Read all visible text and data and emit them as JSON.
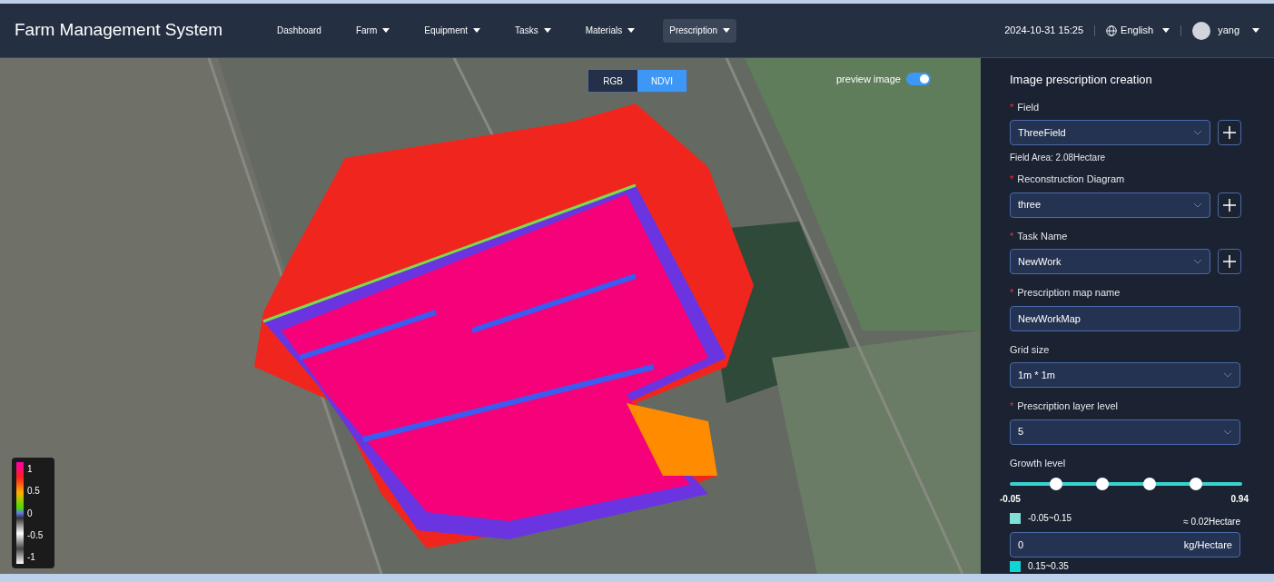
{
  "header": {
    "title": "Farm Management System",
    "nav": [
      {
        "label": "Dashboard",
        "dropdown": false,
        "selected": false
      },
      {
        "label": "Farm",
        "dropdown": true,
        "selected": false
      },
      {
        "label": "Equipment",
        "dropdown": true,
        "selected": false
      },
      {
        "label": "Tasks",
        "dropdown": true,
        "selected": false
      },
      {
        "label": "Materials",
        "dropdown": true,
        "selected": false
      },
      {
        "label": "Prescription",
        "dropdown": true,
        "selected": true
      }
    ],
    "datetime": "2024-10-31 15:25",
    "language": "English",
    "user": "yang"
  },
  "map": {
    "view_modes": [
      {
        "label": "RGB",
        "selected": false
      },
      {
        "label": "NDVI",
        "selected": true
      }
    ],
    "preview": {
      "label": "preview image",
      "on": true
    },
    "legend": [
      "1",
      "0.5",
      "0",
      "-0.5",
      "-1"
    ]
  },
  "panel": {
    "title": "Image prescription creation",
    "fields": [
      {
        "kind": "select_add",
        "label": "Field",
        "required_mark": "*",
        "value": "ThreeField",
        "note": "Field Area: 2.08Hectare"
      },
      {
        "kind": "select_add",
        "label": "Reconstruction Diagram",
        "required_mark": "*",
        "value": "three"
      },
      {
        "kind": "select_add",
        "label": "Task Name",
        "required_mark": "*",
        "value": "NewWork"
      },
      {
        "kind": "input",
        "label": "Prescription map name",
        "required_mark": "*",
        "value": "NewWorkMap"
      },
      {
        "kind": "select",
        "label": "Grid size",
        "value": "1m * 1m"
      },
      {
        "kind": "select",
        "label": "Prescription layer level",
        "required_mark": "*",
        "value": "5"
      }
    ],
    "growth": {
      "label": "Growth level",
      "min": "-0.05",
      "max": "0.94",
      "thumbs": [
        {
          "level": 0.2
        },
        {
          "level": 0.4
        },
        {
          "level": 0.6
        },
        {
          "level": 0.8
        }
      ]
    },
    "ranges": [
      {
        "color": "#7fe0d8",
        "range": "-0.05~0.15",
        "area": "≈ 0.02Hectare",
        "value": "0",
        "unit": "kg/Hectare"
      },
      {
        "color": "#11d4d4",
        "range": "0.15~0.35"
      }
    ]
  }
}
